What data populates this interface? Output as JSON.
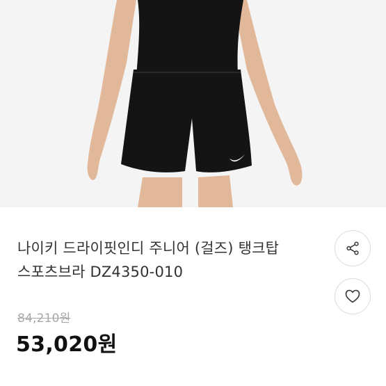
{
  "product": {
    "image_alt": "black running shorts product photo",
    "title_line1": "나이키 드라이핏인디 주니어 (걸즈) 탱크탑",
    "title_line2": "스포츠브라 DZ4350-010",
    "original_price": "84,210원",
    "sale_price": "53,020원"
  },
  "actions": {
    "share_icon": "share-icon",
    "like_icon": "heart-icon"
  },
  "colors": {
    "image_background": "#f4f4f4",
    "garment": "#141414",
    "skin": "#e2b89a",
    "strikethrough_price": "#a8a8a8"
  }
}
